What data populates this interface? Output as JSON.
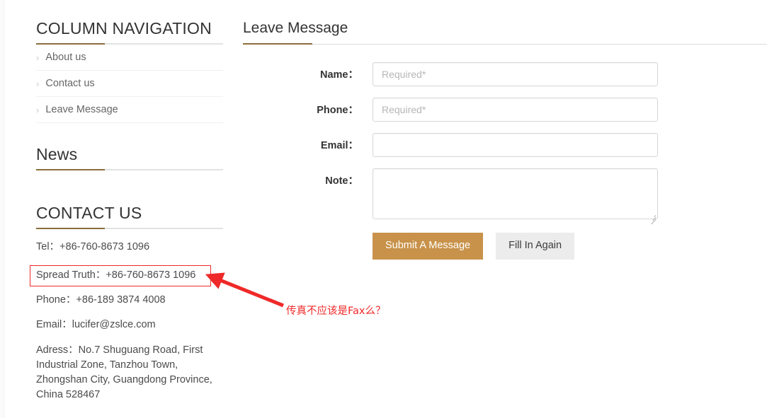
{
  "sidebar": {
    "nav_section": {
      "title": "COLUMN NAVIGATION",
      "items": [
        {
          "label": "About us",
          "icon": "chevron-right-icon"
        },
        {
          "label": "Contact us",
          "icon": "chevron-right-icon"
        },
        {
          "label": "Leave Message",
          "icon": "chevron-right-icon"
        }
      ]
    },
    "news_section": {
      "title": "News"
    },
    "contact_section": {
      "title": "CONTACT US",
      "lines": [
        {
          "text": "Tel：+86-760-8673 1096",
          "highlighted": false
        },
        {
          "text": "Spread Truth：+86-760-8673 1096",
          "highlighted": true
        },
        {
          "text": "Phone：+86-189 3874 4008",
          "highlighted": false
        },
        {
          "text": "Email：lucifer@zslce.com",
          "highlighted": false
        }
      ],
      "address": "Adress：No.7 Shuguang Road, First Industrial Zone, Tanzhou Town, Zhongshan City, Guangdong Province, China 528467"
    }
  },
  "main": {
    "title": "Leave Message",
    "form": {
      "fields": [
        {
          "label": "Name：",
          "placeholder": "Required*",
          "value": "",
          "type": "text"
        },
        {
          "label": "Phone：",
          "placeholder": "Required*",
          "value": "",
          "type": "text"
        },
        {
          "label": "Email：",
          "placeholder": "",
          "value": "",
          "type": "text"
        },
        {
          "label": "Note：",
          "placeholder": "",
          "value": "",
          "type": "textarea"
        }
      ],
      "submit_label": "Submit A Message",
      "reset_label": "Fill In Again"
    }
  },
  "annotation": {
    "text": "传真不应该是Fax么？",
    "color": "#ef2929"
  },
  "colors": {
    "accent_brown": "#8a6d3b",
    "submit_button": "#c8924a",
    "reset_button": "#ececec",
    "annotation_red": "#ef2929",
    "heading_text": "#333333",
    "body_text": "#4b4b4b"
  }
}
